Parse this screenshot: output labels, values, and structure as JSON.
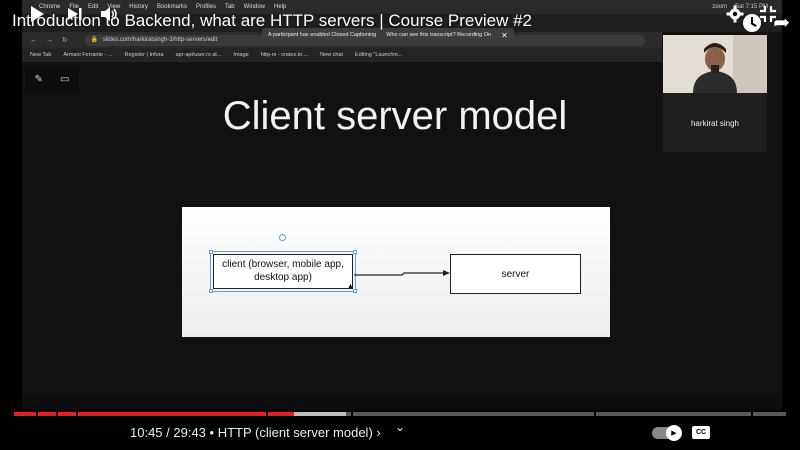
{
  "video": {
    "title": "Introduction to Backend, what are HTTP servers | Course Preview #2",
    "time": "10:45 / 29:43",
    "chapter": "• HTTP (client server model)",
    "chapter_chevron": "›",
    "progress_played_fraction": 0.363,
    "progress_buffered_fraction": 0.43
  },
  "screen": {
    "menubar": [
      "Chrome",
      "File",
      "Edit",
      "View",
      "History",
      "Bookmarks",
      "Profiles",
      "Tab",
      "Window",
      "Help"
    ],
    "menubar_right": [
      "zoom",
      "Sat 7:15 PM"
    ],
    "url": "slides.com/harkiratsingh-3/http-servers/edit",
    "bookmarks": [
      "New Tab",
      "Armani Ferrante - ...",
      "Register | Infura",
      "apr-api/user.rs at...",
      "Image",
      "http-rs - crates.io:...",
      "New chat",
      "Editing \"Launchin..."
    ],
    "cc_banner": "A participant has enabled Closed Captioning",
    "cc_banner_2": "Who can see this transcript? Recording On",
    "cc_close": "✕"
  },
  "slide": {
    "title": "Client server model",
    "client_label": "client (browser, mobile app, desktop app)",
    "server_label": "server"
  },
  "participant": {
    "name": "harkirat singh"
  },
  "icons": {
    "play": "play-icon",
    "next": "next-icon",
    "volume": "volume-icon",
    "settings": "gear-icon",
    "fullscreen": "exit-fullscreen-icon",
    "cc": "CC"
  }
}
